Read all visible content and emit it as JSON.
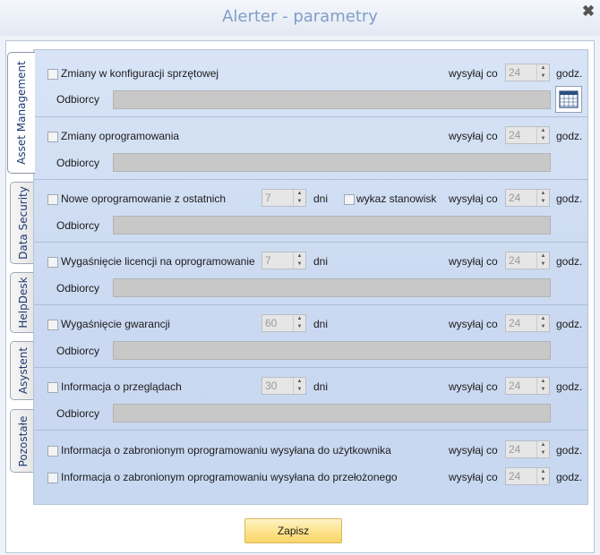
{
  "window": {
    "title": "Alerter - parametry",
    "close_icon": "close-icon"
  },
  "tabs": [
    {
      "label": "Asset Management",
      "active": true
    },
    {
      "label": "Data Security",
      "active": false
    },
    {
      "label": "HelpDesk",
      "active": false
    },
    {
      "label": "Asystent",
      "active": false
    },
    {
      "label": "Pozostałe",
      "active": false
    }
  ],
  "common": {
    "send_every": "wysyłaj co",
    "hours": "godz.",
    "days": "dni",
    "recipients": "Odbiorcy"
  },
  "sections": {
    "hardware": {
      "label": "Zmiany w konfiguracji sprzętowej",
      "interval": "24",
      "recipients": ""
    },
    "software": {
      "label": "Zmiany oprogramowania",
      "interval": "24",
      "recipients": ""
    },
    "new_software": {
      "label": "Nowe oprogramowanie z ostatnich",
      "days": "7",
      "workstation_list_label": "wykaz stanowisk",
      "interval": "24",
      "recipients": ""
    },
    "license_expiry": {
      "label": "Wygaśnięcie licencji na oprogramowanie",
      "days": "7",
      "interval": "24",
      "recipients": ""
    },
    "warranty_expiry": {
      "label": "Wygaśnięcie gwarancji",
      "days": "60",
      "interval": "24",
      "recipients": ""
    },
    "reviews": {
      "label": "Informacja o przeglądach",
      "days": "30",
      "interval": "24",
      "recipients": ""
    },
    "forbidden_user": {
      "label": "Informacja o zabronionym oprogramowaniu wysyłana do użytkownika",
      "interval": "24"
    },
    "forbidden_supervisor": {
      "label": "Informacja o zabronionym oprogramowaniu wysyłana do przełożonego",
      "interval": "24"
    }
  },
  "footer": {
    "save_label": "Zapisz"
  }
}
